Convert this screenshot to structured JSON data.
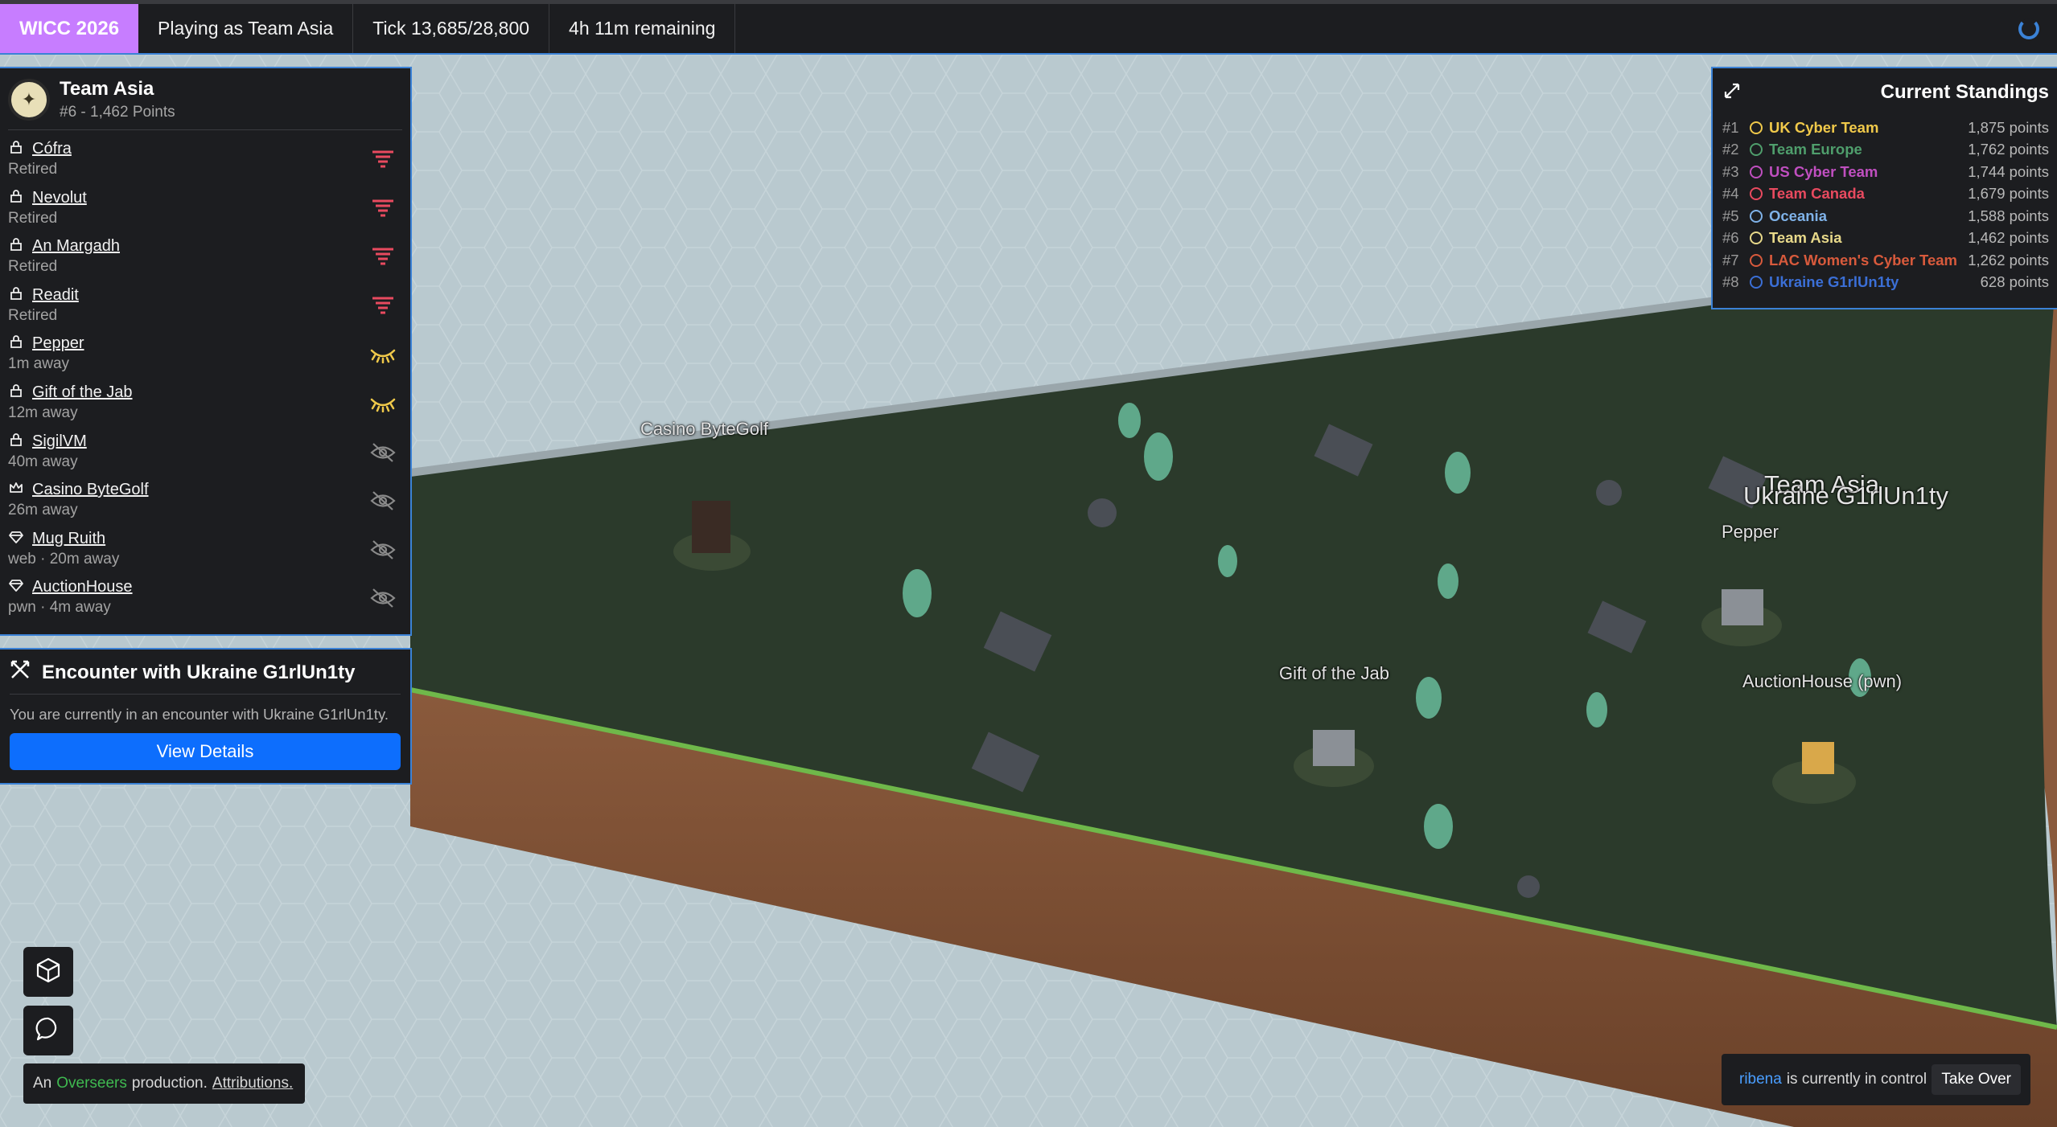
{
  "topbar": {
    "brand": "WICC 2026",
    "playing": "Playing as Team Asia",
    "tick": "Tick 13,685/28,800",
    "remaining": "4h 11m remaining"
  },
  "team": {
    "name": "Team Asia",
    "sub": "#6 - 1,462 Points"
  },
  "services": [
    {
      "icon": "lock-icon",
      "name": "Cófra",
      "status": "Retired",
      "indicator": "retired"
    },
    {
      "icon": "lock-icon",
      "name": "Nevolut",
      "status": "Retired",
      "indicator": "retired"
    },
    {
      "icon": "lock-icon",
      "name": "An Margadh",
      "status": "Retired",
      "indicator": "retired"
    },
    {
      "icon": "lock-icon",
      "name": "Readit",
      "status": "Retired",
      "indicator": "retired"
    },
    {
      "icon": "lock-icon",
      "name": "Pepper",
      "status": "1m away",
      "indicator": "watching"
    },
    {
      "icon": "lock-icon",
      "name": "Gift of the Jab",
      "status": "12m away",
      "indicator": "watching"
    },
    {
      "icon": "lock-icon",
      "name": "SigilVM",
      "status": "40m away",
      "indicator": "hidden"
    },
    {
      "icon": "crown-icon",
      "name": "Casino ByteGolf",
      "status": "26m away",
      "indicator": "hidden"
    },
    {
      "icon": "gem-icon",
      "name": "Mug Ruith",
      "status": "web · 20m away",
      "indicator": "hidden"
    },
    {
      "icon": "gem-icon",
      "name": "AuctionHouse",
      "status": "pwn · 4m away",
      "indicator": "hidden"
    }
  ],
  "encounter": {
    "title": "Encounter with Ukraine G1rlUn1ty",
    "text": "You are currently in an encounter with Ukraine G1rlUn1ty.",
    "button": "View Details"
  },
  "standings": {
    "title": "Current Standings",
    "rows": [
      {
        "rank": "#1",
        "name": "UK Cyber Team",
        "points": "1,875 points",
        "color": "#f0c94a"
      },
      {
        "rank": "#2",
        "name": "Team Europe",
        "points": "1,762 points",
        "color": "#4f9e6c"
      },
      {
        "rank": "#3",
        "name": "US Cyber Team",
        "points": "1,744 points",
        "color": "#c04fc0"
      },
      {
        "rank": "#4",
        "name": "Team Canada",
        "points": "1,679 points",
        "color": "#e84a5f"
      },
      {
        "rank": "#5",
        "name": "Oceania",
        "points": "1,588 points",
        "color": "#7fb2e8"
      },
      {
        "rank": "#6",
        "name": "Team Asia",
        "points": "1,462 points",
        "color": "#e8d98a"
      },
      {
        "rank": "#7",
        "name": "LAC Women's Cyber Team",
        "points": "1,262 points",
        "color": "#d85a3c"
      },
      {
        "rank": "#8",
        "name": "Ukraine G1rlUn1ty",
        "points": "628 points",
        "color": "#3b6fd6"
      }
    ]
  },
  "map_labels": {
    "casino": "Casino ByteGolf",
    "gift": "Gift of the Jab",
    "auction": "AuctionHouse (pwn)",
    "pepper": "Pepper",
    "team_asia": "Team Asia",
    "ukraine": "Ukraine G1rlUn1ty"
  },
  "credit": {
    "prefix": "An",
    "brand": "Overseers",
    "middle": "production.",
    "link": "Attributions."
  },
  "control": {
    "user": "ribena",
    "text": "is currently in control",
    "button": "Take Over"
  },
  "colors": {
    "accent": "#3b82d6",
    "brand": "#c77dff",
    "primary_button": "#0d6efd",
    "retired": "#e84a5f",
    "watching": "#f0c94a",
    "hidden": "#8a8a8a"
  }
}
